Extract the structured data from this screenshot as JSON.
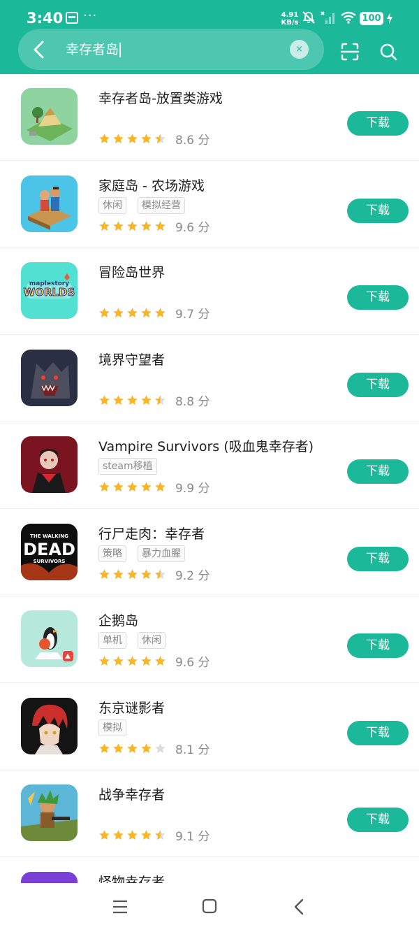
{
  "status_bar": {
    "time": "3:40",
    "dots": "···",
    "speed_value": "4.91",
    "speed_unit": "KB/s",
    "battery": "100"
  },
  "search": {
    "query": "幸存者岛",
    "clear_label": "×"
  },
  "colors": {
    "accent": "#1cb89a",
    "star_full": "#f7b52c",
    "star_empty": "#dcdcdc"
  },
  "download_label": "下载",
  "score_unit": "分",
  "apps": [
    {
      "name": "幸存者岛-放置类游戏",
      "tags": [],
      "rating": 4.5,
      "score": "8.6 分"
    },
    {
      "name": "家庭岛 - 农场游戏",
      "tags": [
        "休闲",
        "模拟经营"
      ],
      "rating": 5,
      "score": "9.6 分"
    },
    {
      "name": "冒险岛世界",
      "tags": [],
      "rating": 5,
      "score": "9.7 分",
      "icon_text": [
        "maplestory",
        "WORLDS"
      ]
    },
    {
      "name": "境界守望者",
      "tags": [],
      "rating": 4.5,
      "score": "8.8 分"
    },
    {
      "name": "Vampire Survivors (吸血鬼幸存者)",
      "tags": [
        "steam移植"
      ],
      "rating": 5,
      "score": "9.9 分"
    },
    {
      "name": "行尸走肉：幸存者",
      "tags": [
        "策略",
        "暴力血腥"
      ],
      "rating": 4.5,
      "score": "9.2 分",
      "icon_text": [
        "THE WALKING",
        "DEAD",
        "SURVIVORS"
      ]
    },
    {
      "name": "企鹅岛",
      "tags": [
        "单机",
        "休闲"
      ],
      "rating": 5,
      "score": "9.6 分"
    },
    {
      "name": "东京谜影者",
      "tags": [
        "模拟"
      ],
      "rating": 4,
      "score": "8.1 分"
    },
    {
      "name": "战争幸存者",
      "tags": [],
      "rating": 4.5,
      "score": "9.1 分"
    },
    {
      "name": "怪物幸存者",
      "tags": [],
      "rating": 0,
      "score": ""
    }
  ],
  "icons": [
    "back-icon",
    "clear-icon",
    "scan-icon",
    "search-icon",
    "star-icon",
    "menu-icon",
    "home-icon",
    "nav-back-icon"
  ]
}
